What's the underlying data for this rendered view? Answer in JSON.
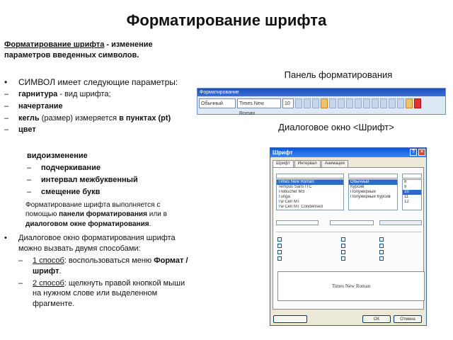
{
  "title": "Форматирование шрифта",
  "definition": {
    "term": "Форматирование шрифта",
    "rest": " - изменение параметров введенных символов."
  },
  "symbol_intro": {
    "bullet": "•",
    "word": "СИМВОЛ",
    "rest": "имеет следующие параметры:"
  },
  "params": [
    {
      "bold": "гарнитура",
      "rest": " - вид шрифта;"
    },
    {
      "bold": "начертание",
      "rest": ""
    },
    {
      "bold": "кегль",
      "rest": " (размер) измеряется ",
      "bold2": "в пунктах (pt)"
    },
    {
      "bold": "цвет",
      "rest": ""
    }
  ],
  "modification": {
    "heading": "видоизменение",
    "items": [
      "подчеркивание",
      "интервал межбуквенный",
      "смещение букв"
    ]
  },
  "note": {
    "text1": "Форматирование шрифта выполняется с помощью ",
    "bold1": "панели форматирования",
    "text2": " или в ",
    "bold2": "диалоговом окне форматирования",
    "text3": "."
  },
  "dialog_intro": {
    "bullet": "•",
    "text": "Диалоговое окно форматирования шрифта можно вызвать двумя способами:"
  },
  "methods": [
    {
      "label": "1 способ",
      "text": ": воспользоваться меню ",
      "bold": "Формат / шрифт",
      "end": "."
    },
    {
      "label": "2 способ",
      "text": ": щелкнуть правой кнопкой мыши на нужном слове или выделенном фрагменте.",
      "bold": "",
      "end": ""
    }
  ],
  "right": {
    "panel_caption": "Панель форматирования",
    "dialog_caption": "Диалоговое окно <Шрифт>"
  },
  "toolbar": {
    "title": "Форматирование",
    "style": "Обычный",
    "font": "Times New Roman",
    "size": "10"
  },
  "font_dialog": {
    "title": "Шрифт",
    "tabs": [
      "Шрифт",
      "Интервал",
      "Анимация"
    ],
    "fonts": [
      "Times New Roman",
      "Tempus Sans ITC",
      "Trebuchet MS",
      "Tunga",
      "Tw Cen MT",
      "Tw Cen MT Condensed"
    ],
    "styles": [
      "Обычный",
      "Курсив",
      "Полужирный",
      "Полужирный Курсив"
    ],
    "sizes": [
      "8",
      "9",
      "10",
      "11",
      "12"
    ],
    "preview": "Times New Roman",
    "ok": "OK",
    "cancel": "Отмена"
  },
  "colors": {
    "toolbar_title": "#1f4fb8",
    "dialog_title": "#0a57d8",
    "selection": "#316ac5"
  }
}
